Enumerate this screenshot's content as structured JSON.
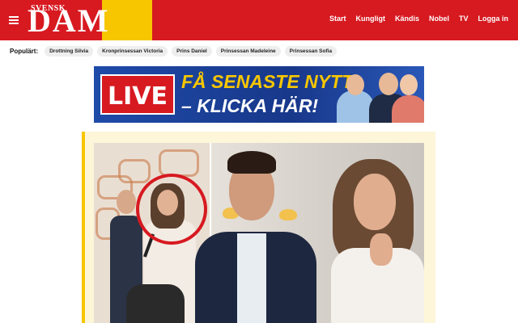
{
  "header": {
    "logo_small": "SVENSK",
    "logo_big": "DAM",
    "nav": [
      "Start",
      "Kungligt",
      "Kändis",
      "Nobel",
      "TV",
      "Logga in"
    ],
    "menu_icon": "hamburger-menu-icon"
  },
  "popular": {
    "label": "Populärt:",
    "chips": [
      "Drottning Silvia",
      "Kronprinsessan Victoria",
      "Prins Daniel",
      "Prinsessan Madeleine",
      "Prinsessan Sofia"
    ]
  },
  "banner": {
    "live": "LIVE",
    "line1": "FÅ SENASTE NYTT",
    "line2": "– KLICKA HÄR!"
  },
  "colors": {
    "brand_red": "#d71920",
    "brand_yellow": "#f7c600",
    "banner_blue": "#1a3a8c",
    "card_bg": "#fdf6d8"
  }
}
